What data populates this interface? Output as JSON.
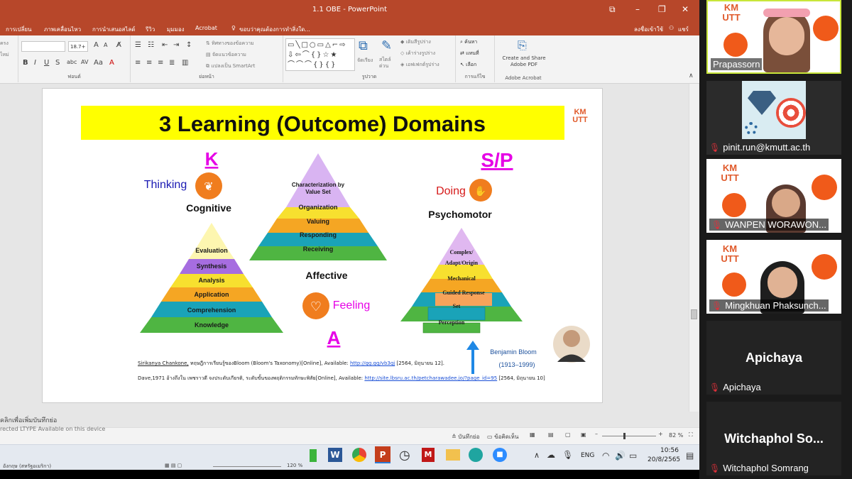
{
  "window": {
    "title": "1.1 OBE - PowerPoint"
  },
  "tabs": [
    "การเปลี่ยน",
    "ภาพเคลื่อนไหว",
    "การนำเสนอสไลด์",
    "รีวิว",
    "มุมมอง",
    "Acrobat"
  ],
  "tell_me": "ขอบว่าคุณต้องการทำสิ่งใด...",
  "signin": "ลงชื่อเข้าใช้",
  "share": "แชร์",
  "ribbon": {
    "font_group": "ฟอนต์",
    "font_size": "18.7+",
    "para_group": "ย่อหน้า",
    "text_direction": "ทิศทางของข้อความ",
    "align_text": "จัดแนวข้อความ",
    "smartart": "แปลงเป็น SmartArt",
    "drawing_group": "รูปวาด",
    "arrange": "จัดเรียง",
    "quick_styles": "สไตล์ด่วน",
    "shape_fill": "เติมสีรูปร่าง",
    "shape_outline": "เค้าร่างรูปร่าง",
    "shape_effects": "เอฟเฟกต์รูปร่าง",
    "find": "ค้นหา",
    "replace": "แทนที่",
    "select": "เลือก",
    "edit_group": "การแก้ไข",
    "create_pdf": "Create and Share Adobe PDF",
    "adobe_group": "Adobe Acrobat",
    "left_cut1": "ครง",
    "left_cut2": "ไหม่"
  },
  "slide": {
    "title": "3 Learning (Outcome) Domains",
    "logo": "KM UTT",
    "k_letter": "K",
    "k_word": "Thinking",
    "k_domain": "Cognitive",
    "a_letter": "A",
    "a_word": "Feeling",
    "a_domain": "Affective",
    "sp_letter": "S/P",
    "sp_word": "Doing",
    "sp_domain": "Psychomotor",
    "cognitive_levels": [
      "Evaluation",
      "Synthesis",
      "Analysis",
      "Application",
      "Comprehension",
      "Knowledge"
    ],
    "affective_levels": [
      "Characterization by Value Set",
      "Organization",
      "Valuing",
      "Responding",
      "Receiving"
    ],
    "psychomotor_levels": [
      "Complex/ Adapt/Origin",
      "Mechanical",
      "Guided Response",
      "Set",
      "Perception"
    ],
    "bloom_name": "Benjamin Bloom",
    "bloom_years": "(1913–1999)",
    "ref1_author": "Sirikanya Chankone,",
    "ref1_text": "ทฤษฎีการเรียนรู้ของBloom (Bloom's Taxonomy)[Online], Available:",
    "ref1_link": "http://gg.gg/vb3gj",
    "ref1_date": "[2564, มิถุนายน 12].",
    "ref2_text": "Dave,1971 อ้างถึงใน เพชราวดี จงประดับเกียรติ, ระดับขั้นของพฤติกรรมทักษะพิสัย[Online], Available:",
    "ref2_link": "http://site.lbsru.ac.th/petcharawadee.jo/?page_id=95",
    "ref2_date": "[2564, มิถุนายน 10]"
  },
  "notes": "คลิกเพื่อเพิ่มบันทึกย่อ",
  "status": {
    "notes_btn": "บันทึกย่อ",
    "comments_btn": "ข้อคิดเห็น",
    "zoom": "82 %",
    "left_text": "rected  LTYPE    Available on this device"
  },
  "taskbar": {
    "lang": "ENG",
    "time": "10:56",
    "date": "20/8/2565",
    "zoom2": "120 %",
    "left2": "อังกฤษ (สหรัฐอเมริกา)"
  },
  "participants": [
    {
      "name": "Prapassorn",
      "muted": false
    },
    {
      "name": "pinit.run@kmutt.ac.th",
      "muted": true
    },
    {
      "name": "WANPEN WORAWON...",
      "muted": true
    },
    {
      "name": "Mingkhuan Phaksunch...",
      "muted": true
    },
    {
      "name": "Apichaya",
      "big": "Apichaya",
      "muted": true
    },
    {
      "name": "Witchaphol Somrang",
      "big": "Witchaphol So...",
      "muted": true
    }
  ]
}
